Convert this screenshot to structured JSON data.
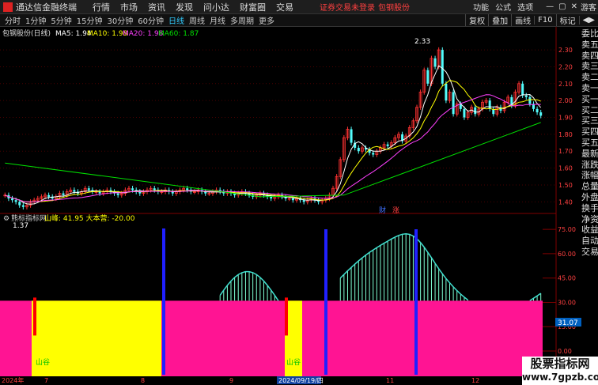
{
  "titlebar": {
    "app_title": "通达信金融终端",
    "menus": [
      "行情",
      "市场",
      "资讯",
      "发现",
      "问小达",
      "财富圈",
      "交易"
    ],
    "warning": "证券交易未登录",
    "stock_link": "包钢股份",
    "right_menus": [
      "功能",
      "公式",
      "选项"
    ],
    "guest": "游客",
    "window_controls": [
      "—",
      "▢",
      "✕"
    ]
  },
  "toolbar": {
    "periods": [
      "分时",
      "1分钟",
      "5分钟",
      "15分钟",
      "30分钟",
      "60分钟",
      "日线",
      "周线",
      "月线",
      "多周期",
      "更多"
    ],
    "active_period": "日线",
    "buttons": [
      "叠加",
      "画线",
      "F10",
      "标记"
    ],
    "prev_button": "复权",
    "flag_button": "◀▶"
  },
  "main_legend": {
    "stock": "包钢股份(日线)",
    "ma5_label": "MA5: 1.94",
    "ma10_label": "MA10: 1.98",
    "ma20_label": "MA20: 1.98",
    "ma60_label": "MA60: 1.87",
    "high_label": "2.33",
    "low_label": "1.37",
    "colors": {
      "ma5": "#ffffff",
      "ma10": "#ffff00",
      "ma20": "#ff40ff",
      "ma60": "#00e000"
    }
  },
  "price_axis": [
    "2.30",
    "2.20",
    "2.10",
    "2.00",
    "1.90",
    "1.80",
    "1.70",
    "1.60",
    "1.50",
    "1.40"
  ],
  "event_markers": [
    "财",
    "涨"
  ],
  "indicator": {
    "name": "熊标指标网",
    "value_label": "山峰: 41.95 大本营: -20.00",
    "axis": [
      "75.00",
      "60.00",
      "45.00",
      "30.00",
      "15.00",
      "0.00"
    ],
    "current_tag": "31.07",
    "zone_labels": [
      "山谷",
      "山谷"
    ]
  },
  "date_axis": [
    "2024年",
    "7",
    "8",
    "9",
    "2024/09/19/四",
    "11",
    "12"
  ],
  "side_panel": {
    "labels": [
      "委比",
      "卖五",
      "卖四",
      "卖三",
      "卖二",
      "卖一",
      "买一",
      "买二",
      "买三",
      "买四",
      "买五",
      "最新",
      "涨跌",
      "涨幅",
      "总量",
      "外盘",
      "换手",
      "净资",
      "收益",
      "自动",
      "交易"
    ]
  },
  "watermark": {
    "line1": "股票指标网",
    "line2": "www.7gpzb.com"
  },
  "chart_data": {
    "type": "candlestick",
    "title": "包钢股份(日线)",
    "x": [
      "2024年",
      "7",
      "8",
      "9",
      "2024/09/19/四",
      "11",
      "12"
    ],
    "ylim": [
      1.35,
      2.38
    ],
    "y_ticks": [
      1.4,
      1.5,
      1.6,
      1.7,
      1.8,
      1.9,
      2.0,
      2.1,
      2.2,
      2.3
    ],
    "series": [
      {
        "name": "MA5",
        "latest": 1.94
      },
      {
        "name": "MA10",
        "latest": 1.98
      },
      {
        "name": "MA20",
        "latest": 1.98
      },
      {
        "name": "MA60",
        "latest": 1.87
      }
    ],
    "close": [
      1.44,
      1.42,
      1.41,
      1.4,
      1.38,
      1.37,
      1.38,
      1.4,
      1.41,
      1.42,
      1.43,
      1.44,
      1.43,
      1.42,
      1.43,
      1.45,
      1.44,
      1.46,
      1.47,
      1.46,
      1.45,
      1.46,
      1.48,
      1.47,
      1.46,
      1.46,
      1.45,
      1.46,
      1.47,
      1.46,
      1.45,
      1.44,
      1.45,
      1.47,
      1.48,
      1.47,
      1.46,
      1.45,
      1.46,
      1.47,
      1.48,
      1.47,
      1.46,
      1.46,
      1.47,
      1.46,
      1.45,
      1.46,
      1.47,
      1.48,
      1.47,
      1.46,
      1.46,
      1.47,
      1.46,
      1.45,
      1.45,
      1.46,
      1.47,
      1.46,
      1.45,
      1.46,
      1.45,
      1.44,
      1.45,
      1.46,
      1.45,
      1.44,
      1.43,
      1.44,
      1.45,
      1.44,
      1.43,
      1.42,
      1.43,
      1.44,
      1.43,
      1.42,
      1.42,
      1.41,
      1.42,
      1.41,
      1.4,
      1.41,
      1.42,
      1.41,
      1.4,
      1.41,
      1.42,
      1.44,
      1.48,
      1.55,
      1.65,
      1.78,
      1.83,
      1.75,
      1.72,
      1.7,
      1.72,
      1.71,
      1.69,
      1.68,
      1.7,
      1.72,
      1.74,
      1.73,
      1.75,
      1.78,
      1.8,
      1.76,
      1.79,
      1.84,
      1.88,
      1.96,
      2.05,
      2.18,
      2.1,
      2.25,
      2.2,
      2.3,
      2.1,
      2.0,
      2.05,
      1.92,
      1.98,
      1.95,
      1.9,
      1.93,
      1.96,
      1.92,
      1.95,
      1.99,
      2.0,
      1.95,
      1.92,
      1.96,
      1.94,
      1.99,
      2.02,
      1.97,
      2.05,
      2.1,
      2.03,
      2.02,
      1.98,
      1.95,
      1.93,
      1.91
    ],
    "ma60_endpoints": [
      [
        0,
        1.63
      ],
      [
        70,
        1.43
      ],
      [
        93,
        1.44
      ],
      [
        147,
        1.87
      ]
    ],
    "indicator": {
      "series": [
        {
          "name": "山峰",
          "latest": 41.95
        },
        {
          "name": "大本营",
          "latest": -20.0
        }
      ],
      "ylim": [
        0,
        78
      ],
      "y_ticks": [
        0,
        15,
        30,
        45,
        60,
        75
      ],
      "current": 31.07
    }
  }
}
